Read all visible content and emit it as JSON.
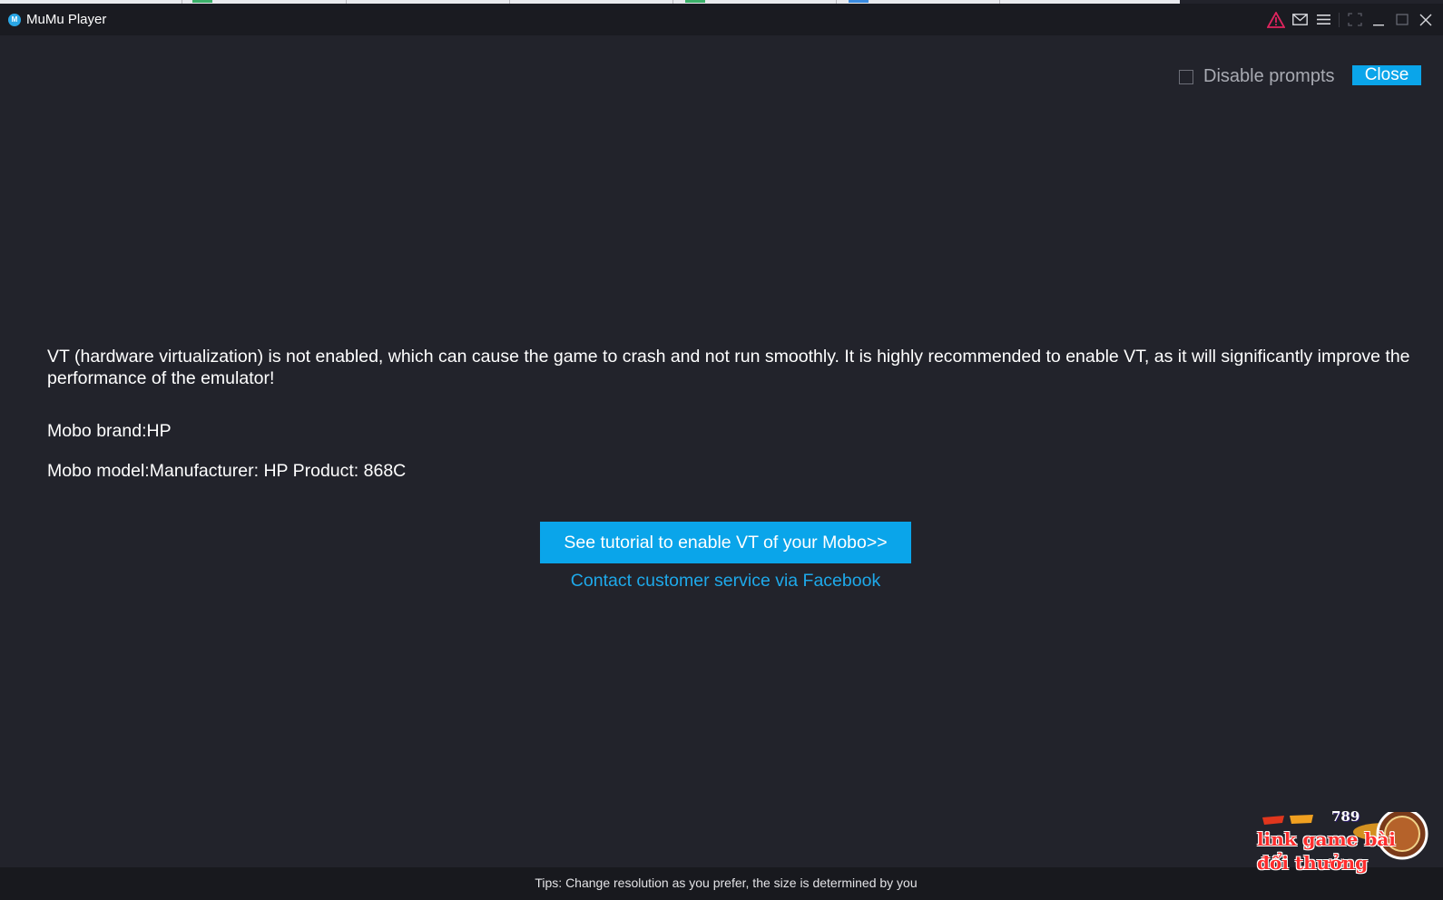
{
  "window": {
    "title": "MuMu Player",
    "logo_glyph": "M"
  },
  "titlebar_icons": [
    "warning-icon",
    "mail-icon",
    "menu-icon",
    "screenshot-icon",
    "minimize-icon",
    "maximize-icon",
    "close-icon"
  ],
  "colors": {
    "background": "#22232b",
    "titlebar": "#1a1b21",
    "accent": "#0aa5ea",
    "link": "#1ea9ea",
    "warning_icon": "#e0245e"
  },
  "prompt": {
    "disable_label": "Disable prompts",
    "disable_checked": false,
    "close_label": "Close"
  },
  "message": {
    "warning": "VT (hardware virtualization) is not enabled, which can cause the game to crash and not run smoothly. It is highly recommended to enable VT, as it will significantly improve the performance of the emulator!",
    "mobo_brand": "Mobo brand:HP",
    "mobo_model": "Mobo model:Manufacturer: HP  Product: 868C"
  },
  "actions": {
    "tutorial_button": "See tutorial to enable VT of your Mobo>>",
    "facebook_link": "Contact customer service via Facebook"
  },
  "footer": {
    "tips": "Tips: Change resolution as you prefer, the size is determined by you"
  },
  "watermark": {
    "line1": "link game bài",
    "line2": "đổi thưởng",
    "badge": "789"
  }
}
